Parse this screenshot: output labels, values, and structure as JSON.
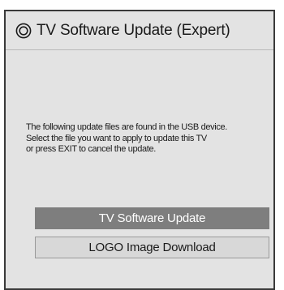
{
  "header": {
    "icon": "settings-circle-icon",
    "title": "TV Software Update (Expert)"
  },
  "message": {
    "lines": [
      "The following update files are found in the USB device.",
      "Select the file you want to apply to update this TV",
      "or press EXIT to cancel the update."
    ]
  },
  "options": [
    {
      "label": "TV Software Update",
      "selected": true
    },
    {
      "label": "LOGO Image Download",
      "selected": false
    }
  ],
  "colors": {
    "panel_background": "#e3e3e3",
    "selected_option": "#7e7e7e",
    "selected_text": "#ffffff",
    "normal_option": "#d8d8d8"
  }
}
